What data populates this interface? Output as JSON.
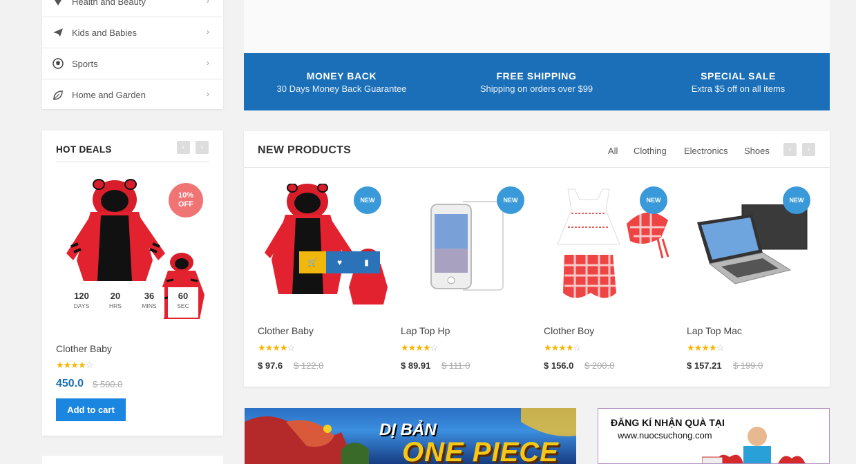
{
  "categories": [
    {
      "label": "Health and Beauty",
      "icon": "diamond-icon"
    },
    {
      "label": "Kids and Babies",
      "icon": "paper-plane-icon"
    },
    {
      "label": "Sports",
      "icon": "soccer-ball-icon"
    },
    {
      "label": "Home and Garden",
      "icon": "leaf-icon"
    }
  ],
  "features": [
    {
      "title": "MONEY BACK",
      "subtitle": "30 Days Money Back Guarantee"
    },
    {
      "title": "FREE SHIPPING",
      "subtitle": "Shipping on orders over $99"
    },
    {
      "title": "SPECIAL SALE",
      "subtitle": "Extra $5 off on all items"
    }
  ],
  "hot_deals": {
    "title": "HOT DEALS",
    "discount": "10% OFF",
    "countdown": [
      {
        "value": "120",
        "unit": "DAYS"
      },
      {
        "value": "20",
        "unit": "HRS"
      },
      {
        "value": "36",
        "unit": "MINS"
      },
      {
        "value": "60",
        "unit": "SEC"
      }
    ],
    "product_name": "Clother Baby",
    "rating": 4,
    "price": "450.0",
    "old_price": "$ 500.0",
    "add_to_cart": "Add to cart"
  },
  "new_products": {
    "title": "NEW PRODUCTS",
    "tabs": [
      "All",
      "Clothing",
      "Electronics",
      "Shoes"
    ],
    "badge": "NEW",
    "items": [
      {
        "name": "Clother Baby",
        "rating": 4,
        "price": "$ 97.6",
        "old_price": "$ 122.0"
      },
      {
        "name": "Lap Top Hp",
        "rating": 4,
        "price": "$ 89.91",
        "old_price": "$ 111.0"
      },
      {
        "name": "Clother Boy",
        "rating": 4,
        "price": "$ 156.0",
        "old_price": "$ 200.0"
      },
      {
        "name": "Lap Top Mac",
        "rating": 4,
        "price": "$ 157.21",
        "old_price": "$ 199.0"
      }
    ]
  },
  "ads": {
    "game_title": "ONE PIECE",
    "game_line1": "DỊ BẢN",
    "promo_line1": "ĐĂNG KÍ NHẬN QUÀ TẠI",
    "promo_line2": "www.nuocsuchong.com"
  },
  "colors": {
    "accent": "#1a6fb8",
    "badge_new": "#3a9ad9",
    "badge_off": "#f07474",
    "star": "#f7b500"
  }
}
